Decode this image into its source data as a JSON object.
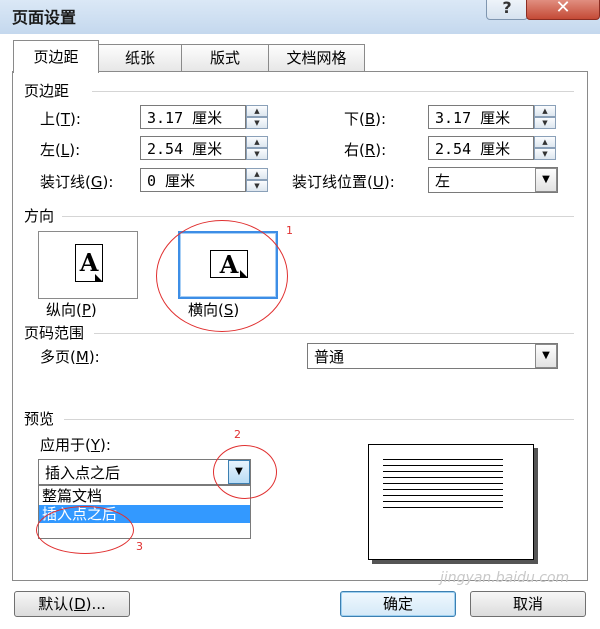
{
  "window": {
    "title": "页面设置",
    "help": "?",
    "close": "✕"
  },
  "tabs": [
    {
      "label": "页边距",
      "active": true
    },
    {
      "label": "纸张",
      "active": false
    },
    {
      "label": "版式",
      "active": false
    },
    {
      "label": "文档网格",
      "active": false
    }
  ],
  "margins": {
    "group_label": "页边距",
    "top_label": "上(",
    "top_key": "T",
    "top_end": "):",
    "top_value": "3.17 厘米",
    "bottom_label": "下(",
    "bottom_key": "B",
    "bottom_end": "):",
    "bottom_value": "3.17 厘米",
    "left_label": "左(",
    "left_key": "L",
    "left_end": "):",
    "left_value": "2.54 厘米",
    "right_label": "右(",
    "right_key": "R",
    "right_end": "):",
    "right_value": "2.54 厘米",
    "gutter_label": "装订线(",
    "gutter_key": "G",
    "gutter_end": "):",
    "gutter_value": "0 厘米",
    "gutter_pos_label": "装订线位置(",
    "gutter_pos_key": "U",
    "gutter_pos_end": "):",
    "gutter_pos_value": "左"
  },
  "orientation": {
    "group_label": "方向",
    "portrait_label": "纵向(",
    "portrait_key": "P",
    "portrait_end": ")",
    "landscape_label": "横向(",
    "landscape_key": "S",
    "landscape_end": ")",
    "icon_letter": "A",
    "selected": "landscape"
  },
  "pages": {
    "group_label": "页码范围",
    "multi_label": "多页(",
    "multi_key": "M",
    "multi_end": "):",
    "multi_value": "普通"
  },
  "preview": {
    "group_label": "预览",
    "apply_label": "应用于(",
    "apply_key": "Y",
    "apply_end": "):",
    "apply_value": "插入点之后",
    "options": [
      "整篇文档",
      "插入点之后"
    ],
    "selected_option": "插入点之后"
  },
  "buttons": {
    "default_label": "默认(",
    "default_key": "D",
    "default_end": ")...",
    "ok": "确定",
    "cancel": "取消"
  },
  "annotations": [
    "1",
    "2",
    "3"
  ],
  "watermark": "jingyan.baidu.com",
  "colors": {
    "selection": "#3399ff",
    "annotation": "#e03030",
    "focus": "#3d8ee6"
  }
}
